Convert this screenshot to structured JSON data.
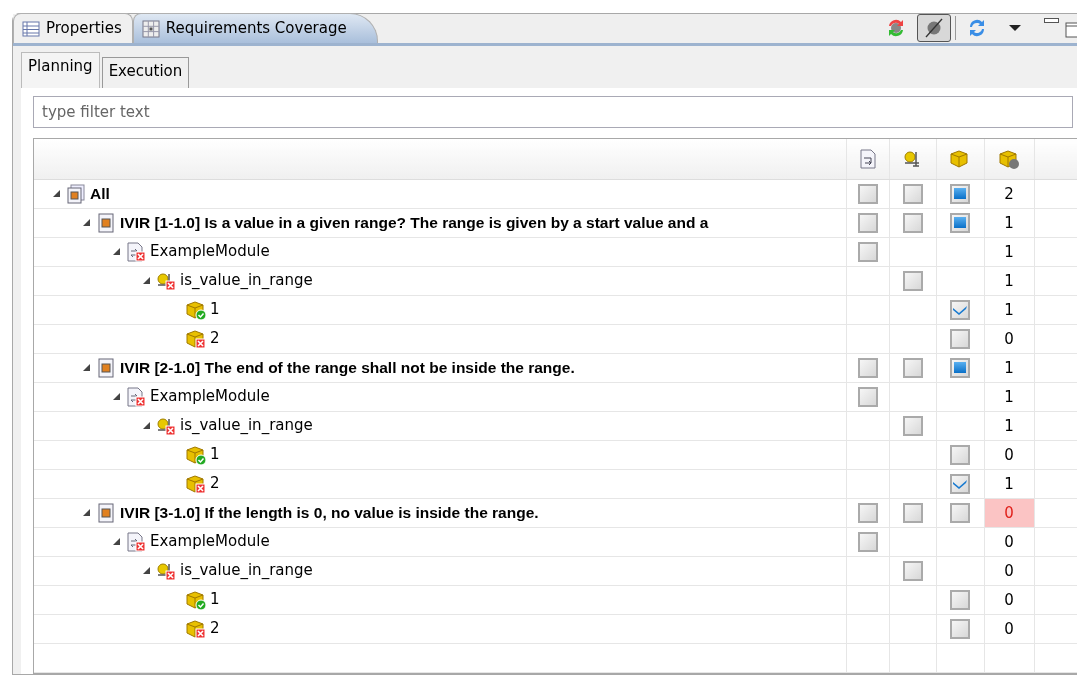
{
  "view_tabs": [
    {
      "label": "Properties",
      "kind": "properties",
      "selected": false
    },
    {
      "label": "Requirements Coverage",
      "kind": "coverage",
      "selected": true
    }
  ],
  "toolbar": [
    {
      "kind": "sync-colored",
      "pressed": false
    },
    {
      "kind": "filter-toggle",
      "pressed": true
    },
    {
      "kind": "refresh",
      "pressed": false
    },
    {
      "kind": "menu",
      "pressed": false
    }
  ],
  "tabs": [
    {
      "label": "Planning",
      "selected": true
    },
    {
      "label": "Execution",
      "selected": false
    }
  ],
  "filter": {
    "placeholder": "type filter text"
  },
  "tree": [
    {
      "kind": "all",
      "label": "All",
      "expanded": true,
      "checks": {
        "column_1": {
          "checked": false
        },
        "column_2": {
          "checked": false
        },
        "column_3": {
          "checked": false,
          "mixed": true
        }
      },
      "count": "2",
      "alert": false,
      "children": [
        {
          "kind": "requirement",
          "label": "IVIR [1-1.0] Is a value in a given range? The range is given by a start value and a",
          "expanded": true,
          "checks": {
            "column_1": {
              "checked": false
            },
            "column_2": {
              "checked": false
            },
            "column_3": {
              "checked": false,
              "mixed": true
            }
          },
          "count": "1",
          "alert": false,
          "children": [
            {
              "kind": "module",
              "label": "ExampleModule",
              "failed": true,
              "expanded": true,
              "checks": {
                "column_1": {
                  "checked": false
                }
              },
              "count": "1",
              "alert": false,
              "children": [
                {
                  "kind": "function",
                  "label": "is_value_in_range",
                  "failed": true,
                  "expanded": true,
                  "checks": {
                    "column_2": {
                      "checked": false
                    }
                  },
                  "count": "1",
                  "alert": false,
                  "children": [
                    {
                      "kind": "testcase",
                      "label": "1",
                      "failed": false,
                      "checks": {
                        "column_3": {
                          "checked": true
                        }
                      },
                      "count": "1",
                      "alert": false
                    },
                    {
                      "kind": "testcase",
                      "label": "2",
                      "failed": true,
                      "checks": {
                        "column_3": {
                          "checked": false
                        }
                      },
                      "count": "0",
                      "alert": false
                    }
                  ]
                }
              ]
            }
          ]
        },
        {
          "kind": "requirement",
          "label": "IVIR [2-1.0] The end of the range shall not be inside the range.",
          "expanded": true,
          "checks": {
            "column_1": {
              "checked": false
            },
            "column_2": {
              "checked": false
            },
            "column_3": {
              "checked": false,
              "mixed": true
            }
          },
          "count": "1",
          "alert": false,
          "children": [
            {
              "kind": "module",
              "label": "ExampleModule",
              "failed": true,
              "expanded": true,
              "checks": {
                "column_1": {
                  "checked": false
                }
              },
              "count": "1",
              "alert": false,
              "children": [
                {
                  "kind": "function",
                  "label": "is_value_in_range",
                  "failed": true,
                  "expanded": true,
                  "checks": {
                    "column_2": {
                      "checked": false
                    }
                  },
                  "count": "1",
                  "alert": false,
                  "children": [
                    {
                      "kind": "testcase",
                      "label": "1",
                      "failed": false,
                      "checks": {
                        "column_3": {
                          "checked": false
                        }
                      },
                      "count": "0",
                      "alert": false
                    },
                    {
                      "kind": "testcase",
                      "label": "2",
                      "failed": true,
                      "checks": {
                        "column_3": {
                          "checked": true
                        }
                      },
                      "count": "1",
                      "alert": false
                    }
                  ]
                }
              ]
            }
          ]
        },
        {
          "kind": "requirement",
          "label": "IVIR [3-1.0] If the length is 0, no value is inside the range.",
          "expanded": true,
          "checks": {
            "column_1": {
              "checked": false
            },
            "column_2": {
              "checked": false
            },
            "column_3": {
              "checked": false
            }
          },
          "count": "0",
          "alert": true,
          "children": [
            {
              "kind": "module",
              "label": "ExampleModule",
              "failed": true,
              "expanded": true,
              "checks": {
                "column_1": {
                  "checked": false
                }
              },
              "count": "0",
              "alert": false,
              "children": [
                {
                  "kind": "function",
                  "label": "is_value_in_range",
                  "failed": true,
                  "expanded": true,
                  "checks": {
                    "column_2": {
                      "checked": false
                    }
                  },
                  "count": "0",
                  "alert": false,
                  "children": [
                    {
                      "kind": "testcase",
                      "label": "1",
                      "failed": false,
                      "checks": {
                        "column_3": {
                          "checked": false
                        }
                      },
                      "count": "0",
                      "alert": false
                    },
                    {
                      "kind": "testcase",
                      "label": "2",
                      "failed": true,
                      "checks": {
                        "column_3": {
                          "checked": false
                        }
                      },
                      "count": "0",
                      "alert": false
                    }
                  ]
                }
              ]
            }
          ]
        }
      ]
    }
  ]
}
